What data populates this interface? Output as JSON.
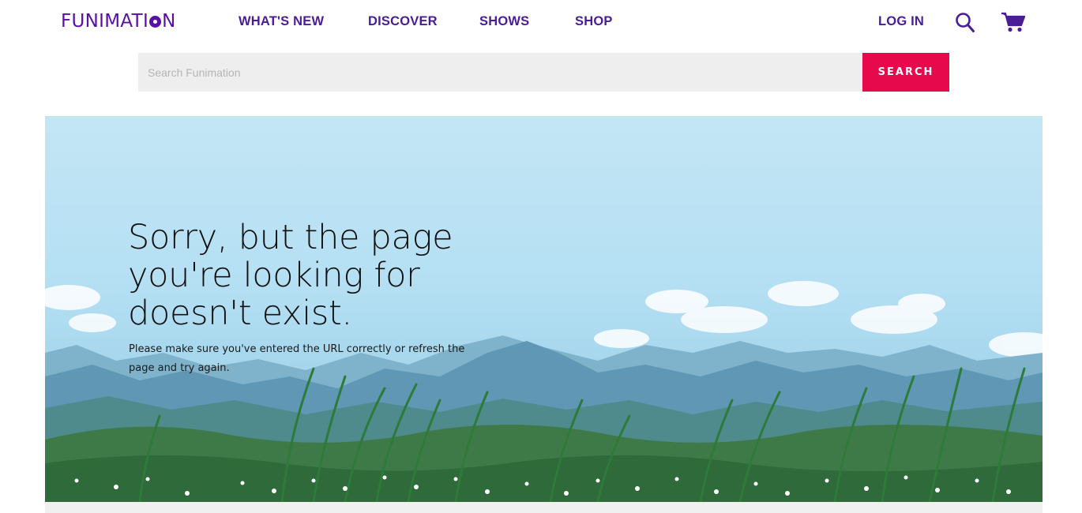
{
  "brand": {
    "logo_pre": "FUNIMATI",
    "logo_post": "N"
  },
  "nav": {
    "items": [
      {
        "label": "WHAT'S NEW"
      },
      {
        "label": "DISCOVER"
      },
      {
        "label": "SHOWS"
      },
      {
        "label": "SHOP"
      }
    ],
    "login_label": "LOG IN",
    "icons": [
      "search-icon",
      "cart-icon"
    ]
  },
  "search": {
    "placeholder": "Search Funimation",
    "value": "",
    "button_label": "SEARCH"
  },
  "error": {
    "headline": "Sorry, but the page you're looking for doesn't exist.",
    "message": "Please make sure you've entered the URL correctly or refresh the page and try again."
  },
  "colors": {
    "brand_purple": "#5a0fa8",
    "nav_purple": "#4a1d96",
    "search_button": "#e6094c",
    "search_field": "#eeeeee"
  }
}
